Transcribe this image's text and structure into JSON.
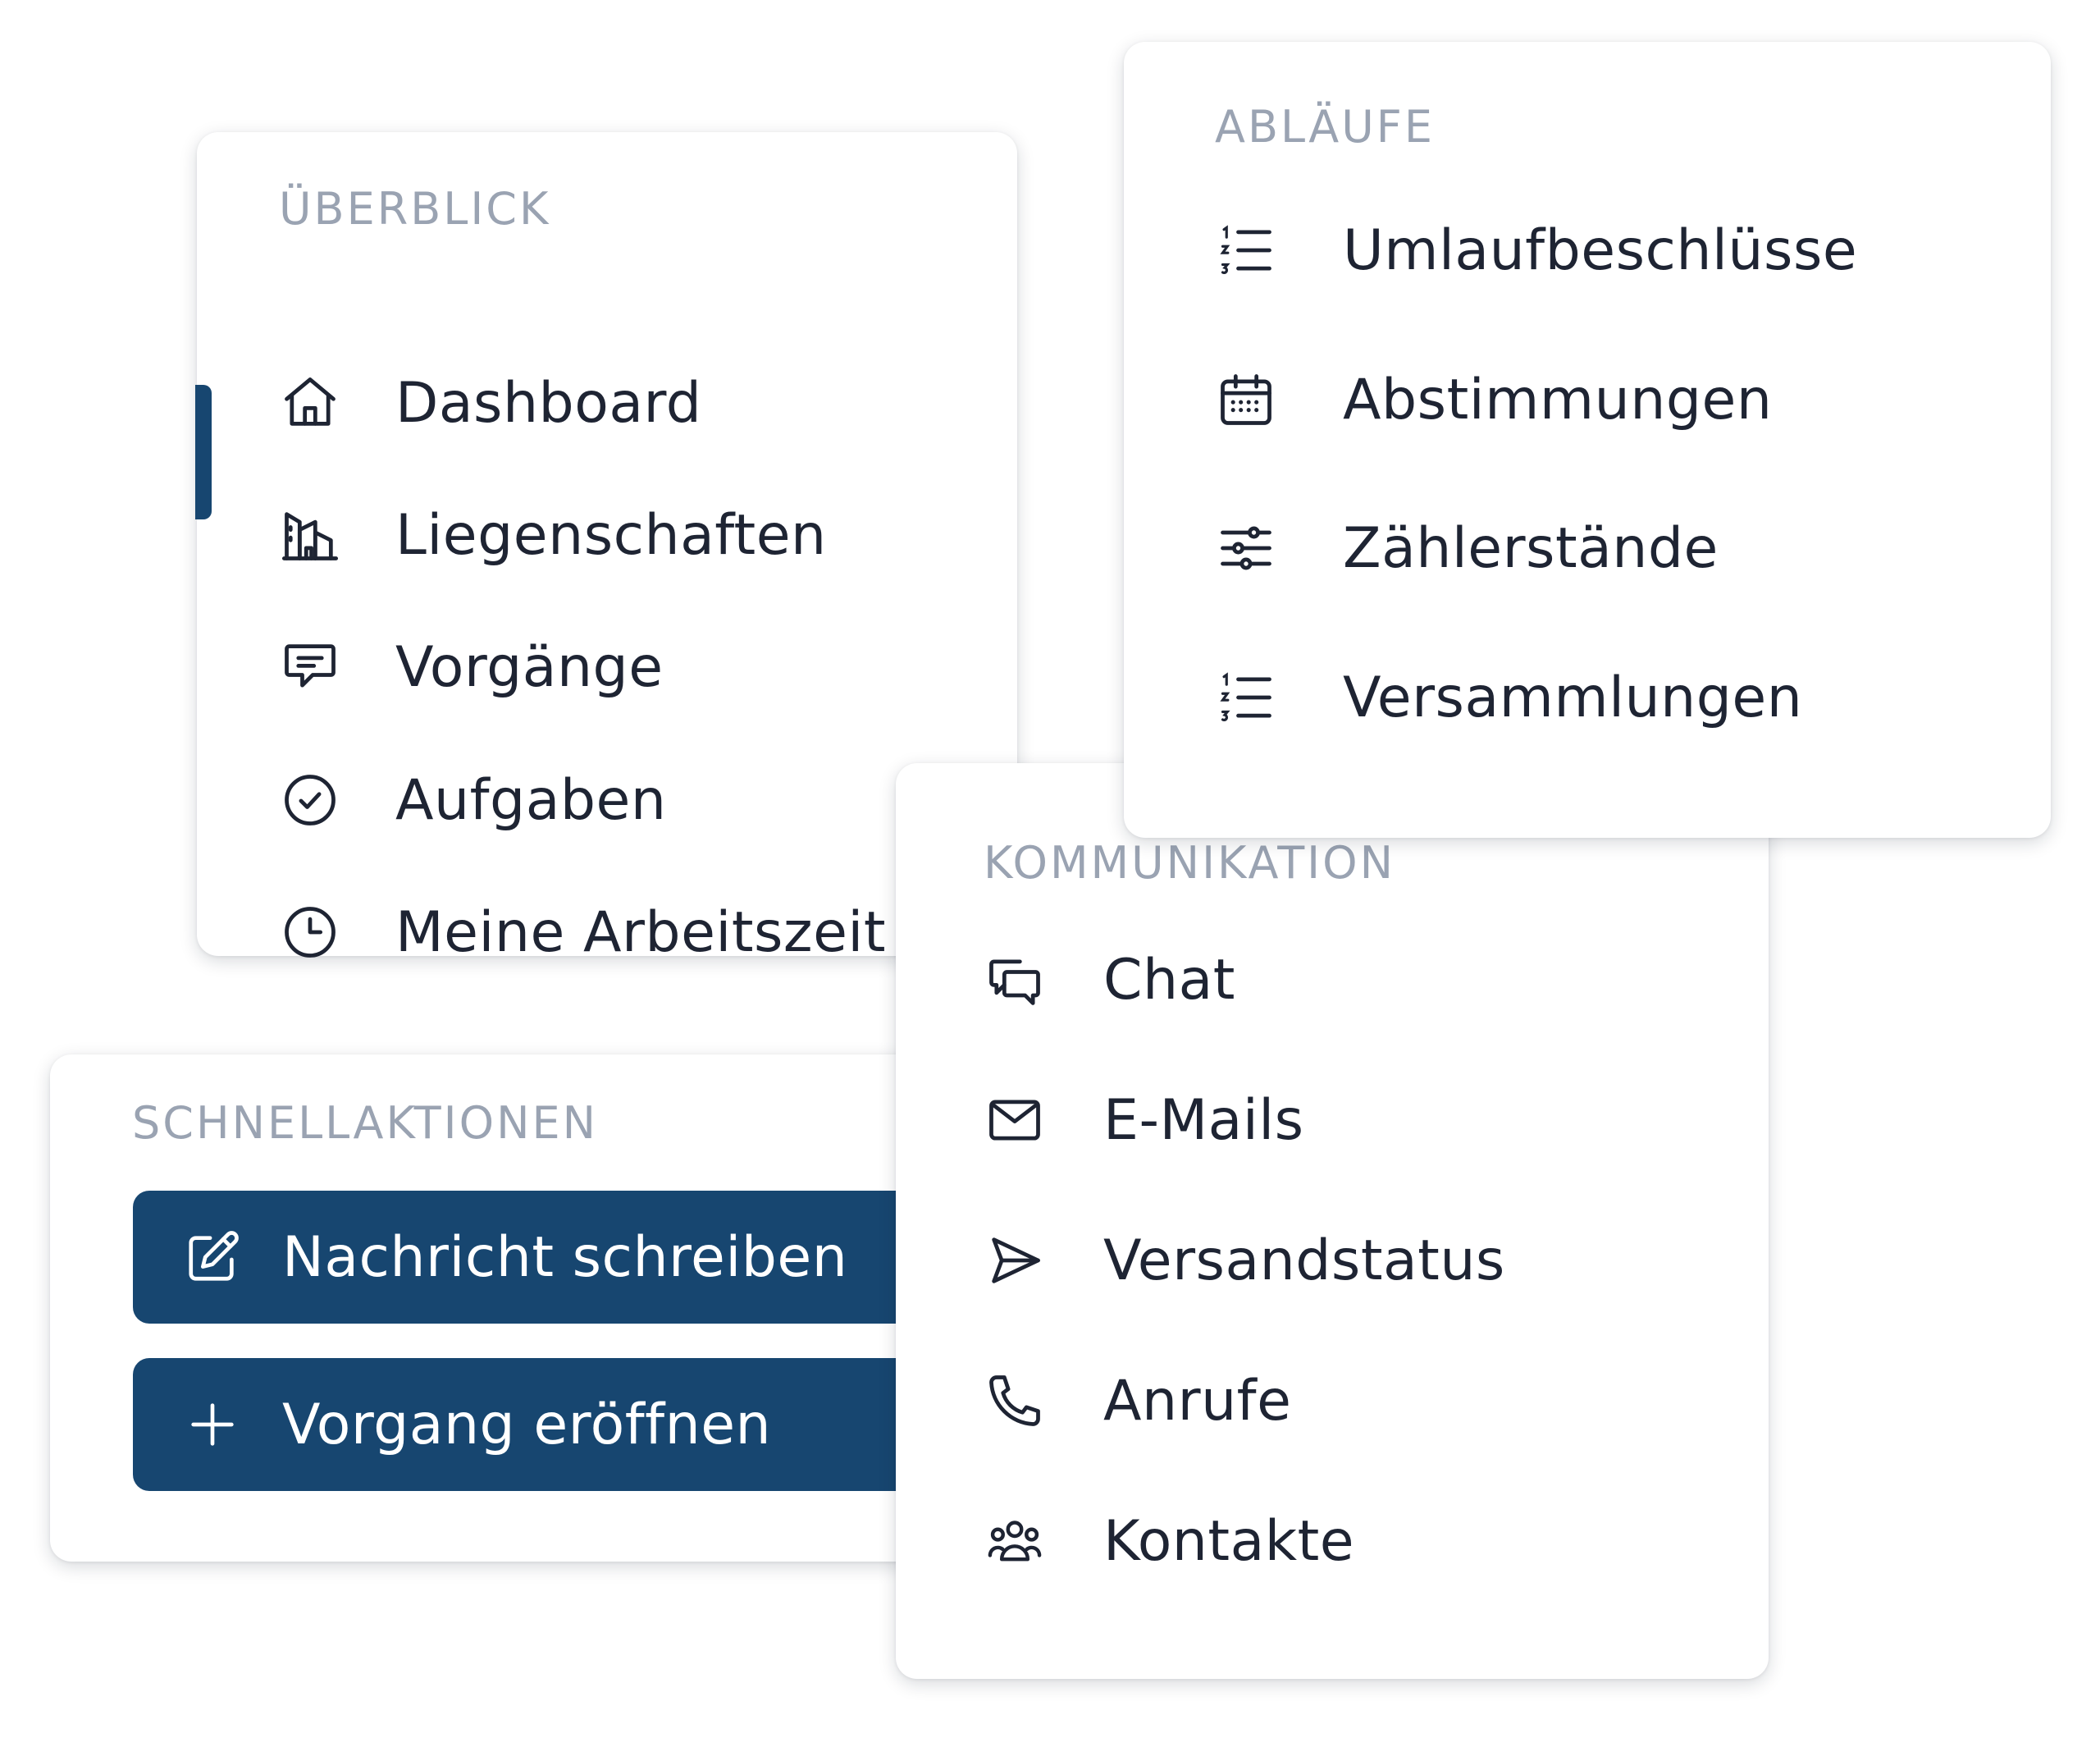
{
  "colors": {
    "primary": "#174670",
    "section_title": "#9aa3b2",
    "text": "#1e2433",
    "card_background": "#ffffff"
  },
  "overview": {
    "title": "ÜBERBLICK",
    "items": [
      {
        "label": "Dashboard",
        "icon": "home-icon",
        "active": true
      },
      {
        "label": "Liegenschaften",
        "icon": "buildings-icon",
        "active": false
      },
      {
        "label": "Vorgänge",
        "icon": "message-square-icon",
        "active": false
      },
      {
        "label": "Aufgaben",
        "icon": "check-circle-icon",
        "active": false
      },
      {
        "label": "Meine Arbeitszeit",
        "icon": "clock-icon",
        "active": false
      }
    ]
  },
  "workflows": {
    "title": "ABLÄUFE",
    "items": [
      {
        "label": "Umlaufbeschlüsse",
        "icon": "ordered-list-icon"
      },
      {
        "label": "Abstimmungen",
        "icon": "calendar-icon"
      },
      {
        "label": "Zählerstände",
        "icon": "sliders-icon"
      },
      {
        "label": "Versammlungen",
        "icon": "ordered-list-icon"
      }
    ]
  },
  "communication": {
    "title": "KOMMUNIKATION",
    "items": [
      {
        "label": "Chat",
        "icon": "chat-bubbles-icon"
      },
      {
        "label": "E-Mails",
        "icon": "envelope-icon"
      },
      {
        "label": "Versandstatus",
        "icon": "send-icon"
      },
      {
        "label": "Anrufe",
        "icon": "phone-icon"
      },
      {
        "label": "Kontakte",
        "icon": "users-icon"
      }
    ]
  },
  "quick_actions": {
    "title": "SCHNELLAKTIONEN",
    "buttons": [
      {
        "label": "Nachricht schreiben",
        "icon": "pencil-square-icon"
      },
      {
        "label": "Vorgang eröffnen",
        "icon": "plus-icon"
      }
    ]
  }
}
